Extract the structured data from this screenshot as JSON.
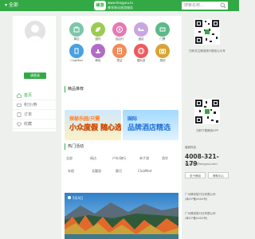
{
  "header": {
    "location": "▾ 全部",
    "logo_mark": "蜂游",
    "logo_url": "www.fengyou.la",
    "logo_slogan": "蜂享移动旅游服务",
    "search_placeholder": "搜索名称..."
  },
  "user": {
    "login_label": "请登录"
  },
  "menu": [
    {
      "label": "首页",
      "icon": "home-icon"
    },
    {
      "label": "积分/券",
      "icon": "coupon-icon"
    },
    {
      "label": "订单",
      "icon": "order-icon"
    },
    {
      "label": "收藏",
      "icon": "favorite-icon"
    }
  ],
  "categories": [
    {
      "label": "周边",
      "color": "#7dc6a9",
      "icon": "bag-icon"
    },
    {
      "label": "国内",
      "color": "#9acb52",
      "icon": "leaf-icon"
    },
    {
      "label": "自由行",
      "color": "#e57ab4",
      "icon": "compass-icon"
    },
    {
      "label": "酒店",
      "color": "#c9a6e0",
      "icon": "bed-icon"
    },
    {
      "label": "门票",
      "color": "#5bb98a",
      "icon": "ticket-icon"
    },
    {
      "label": "ClubMed",
      "color": "#4aa0e0",
      "icon": "building-icon"
    },
    {
      "label": "邮轮",
      "color": "#b06cc4",
      "icon": "ship-icon"
    },
    {
      "label": "签证",
      "color": "#f28a5a",
      "icon": "passport-icon"
    },
    {
      "label": "国际游",
      "color": "#ef5a5a",
      "icon": "globe-icon"
    },
    {
      "label": "旅拍",
      "color": "#d7a534",
      "icon": "camera-icon"
    }
  ],
  "sections": {
    "recommend": "精品推荐",
    "hot": "热门活动"
  },
  "banners": {
    "left_top": "探秘乐园/只需",
    "left_main": "小众度假 随心选",
    "right_top": "国际",
    "right_main": "品牌酒店精选"
  },
  "filter_tabs_row1": [
    "全部",
    "周边",
    "户外/骑行",
    "亲子游",
    "游学"
  ],
  "filter_tabs_row2": [
    "年假",
    "北疆游",
    "蜜月",
    "ClubMed"
  ],
  "photo": {
    "caption": "5月4日"
  },
  "sidebar": {
    "qr1_caption": "扫码关注蜂游旅行微信公众号",
    "qr2_caption": "扫码下载蜂游APP",
    "hotline_label": "客服热线",
    "phone": "4008-321-179",
    "email": "fengyou@fengyou.com",
    "btn_about": "关于蜂游",
    "btn_help": "帮助中心",
    "company1": "广州蜂游旅行社有限公司",
    "company1_sub": "(粤ICP备XXXX号)",
    "company2": "广州蜂游旅行社有限公司",
    "company2_sub": "(粤ICP备XXXX号)"
  },
  "colors": {
    "brand": "#33a946",
    "background": "#eef0ee"
  }
}
